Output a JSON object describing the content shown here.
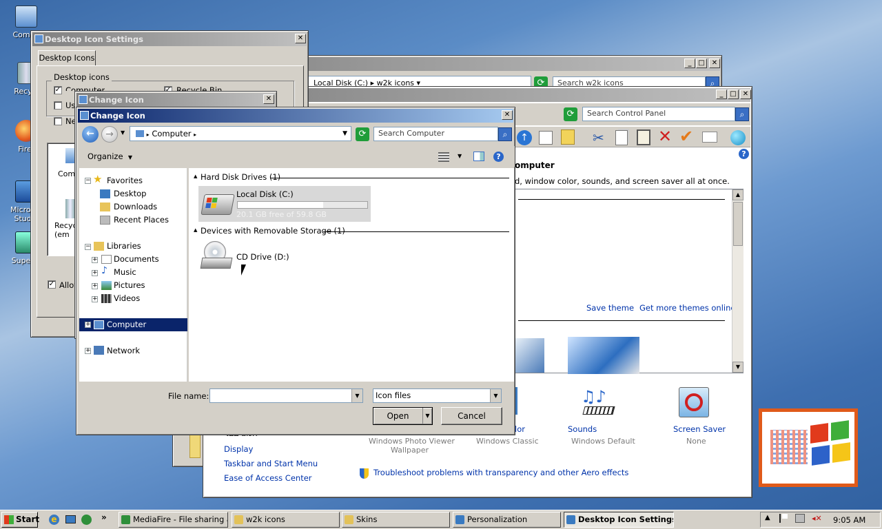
{
  "desktop": {
    "icons": [
      {
        "label": "Compu",
        "icon": "computer-icon"
      },
      {
        "label": "Recycl",
        "icon": "recycle-bin-icon"
      },
      {
        "label": "Firef",
        "icon": "firefox-icon"
      },
      {
        "label": "Microsof Studio",
        "icon": "visual-studio-icon"
      },
      {
        "label": "Superm",
        "icon": "shortcut-icon"
      }
    ]
  },
  "desktop_icon_settings": {
    "title": "Desktop Icon Settings",
    "tab": "Desktop Icons",
    "group_label": "Desktop icons",
    "checkboxes": [
      {
        "label": "Computer",
        "checked": true
      },
      {
        "label": "Us",
        "checked": false
      },
      {
        "label": "Ne",
        "checked": false
      },
      {
        "label": "Recycle Bin",
        "checked": true
      }
    ],
    "preview_items": [
      "Comp",
      "Recyc (em"
    ],
    "allow_label": "Allov"
  },
  "change_icon_small": {
    "title": "Change Icon"
  },
  "explorer_back": {
    "address_local": "Local Disk (C:)",
    "address_folder": "w2k icons",
    "search_placeholder": "Search w2k icons"
  },
  "control_panel": {
    "search_placeholder": "Search Control Panel",
    "heading_fragment": "omputer",
    "description": "d, window color, sounds, and screen saver all at once.",
    "save_theme": "Save theme",
    "more_themes": "Get more themes online",
    "settings": [
      {
        "name": "Color",
        "value": "Windows Classic",
        "icon": "color-icon",
        "name_prefix": "lor"
      },
      {
        "name": "Sounds",
        "value": "Windows Default",
        "icon": "sounds-icon"
      },
      {
        "name": "Screen Saver",
        "value": "None",
        "icon": "screen-saver-icon"
      }
    ],
    "background_caption": [
      "Windows Photo Viewer",
      "Wallpaper"
    ],
    "see_also_title": "See also",
    "see_also": [
      "Display",
      "Taskbar and Start Menu",
      "Ease of Access Center"
    ],
    "troubleshoot": "Troubleshoot problems with transparency and other Aero effects"
  },
  "change_icon_dialog": {
    "title": "Change Icon",
    "address": "Computer",
    "search_placeholder": "Search Computer",
    "organize": "Organize",
    "tree": {
      "favorites": "Favorites",
      "favorites_items": [
        "Desktop",
        "Downloads",
        "Recent Places"
      ],
      "libraries": "Libraries",
      "libraries_items": [
        "Documents",
        "Music",
        "Pictures",
        "Videos"
      ],
      "computer": "Computer",
      "network": "Network"
    },
    "groups": [
      {
        "header": "Hard Disk Drives (1)"
      },
      {
        "header": "Devices with Removable Storage (1)"
      }
    ],
    "local_disk": {
      "name": "Local Disk (C:)",
      "free": "20.1 GB free of 59.8 GB",
      "used_fraction": 0.66
    },
    "cd_drive": {
      "name": "CD Drive (D:)"
    },
    "file_name_label": "File name:",
    "file_name_value": "",
    "file_type": "Icon files",
    "open_label": "Open",
    "cancel_label": "Cancel"
  },
  "taskbar": {
    "start": "Start",
    "tasks": [
      {
        "label": "MediaFire - File sharing a...",
        "color": "#2f8f3a"
      },
      {
        "label": "w2k icons",
        "color": "#e3c25a"
      },
      {
        "label": "Skins",
        "color": "#e3c25a"
      },
      {
        "label": "Personalization",
        "color": "#3a7ac0"
      },
      {
        "label": "Desktop Icon Settings",
        "color": "#3a7ac0",
        "active": true
      }
    ],
    "clock": "9:05 AM"
  },
  "colors": {
    "title_active": "#0a246a",
    "title_inactive": "#808080",
    "selection": "#0a246a"
  }
}
